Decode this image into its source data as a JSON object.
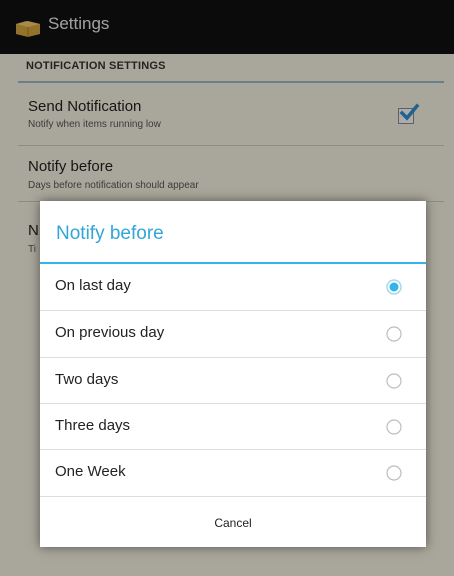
{
  "actionbar": {
    "app_icon": "folder-box-icon",
    "title": "Settings"
  },
  "settings": {
    "section_header": "NOTIFICATION SETTINGS",
    "items": [
      {
        "title": "Send Notification",
        "summary": "Notify when items running low",
        "checked": true
      },
      {
        "title": "Notify before",
        "summary": "Days before notification should appear"
      },
      {
        "title": "N",
        "summary": "Ti"
      }
    ]
  },
  "dialog": {
    "title": "Notify before",
    "options": [
      {
        "label": "On last day",
        "selected": true
      },
      {
        "label": "On previous day",
        "selected": false
      },
      {
        "label": "Two days",
        "selected": false
      },
      {
        "label": "Three days",
        "selected": false
      },
      {
        "label": "One Week",
        "selected": false
      }
    ],
    "cancel_label": "Cancel"
  },
  "colors": {
    "accent": "#33b5e5",
    "title_text": "#33a6d8",
    "checkbox": "#2f8fcf"
  }
}
